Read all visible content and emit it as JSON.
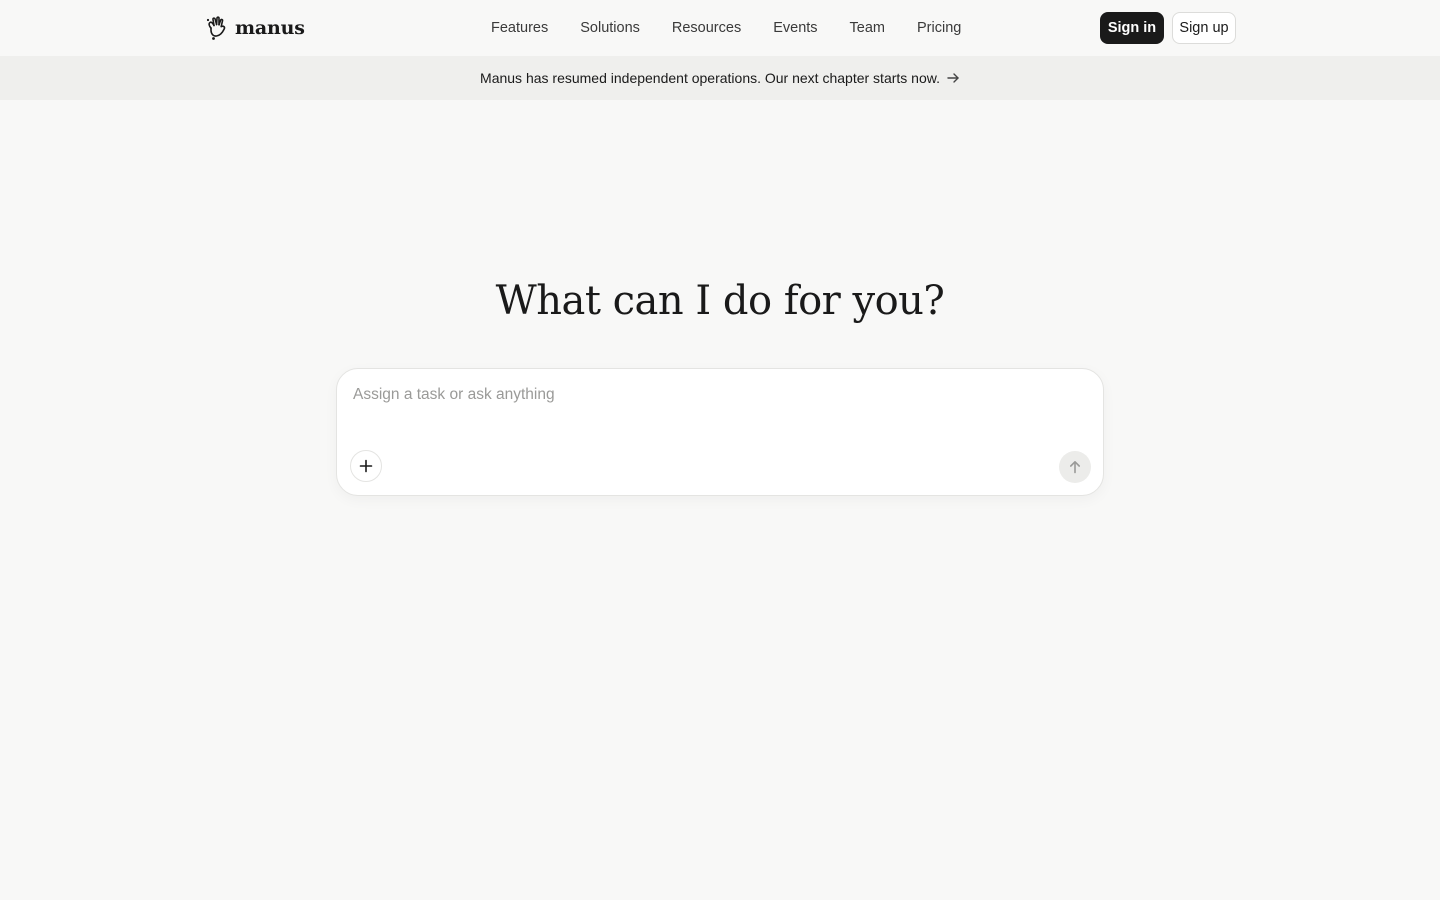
{
  "brand": {
    "name": "manus",
    "logo_icon": "manus-hand-logo"
  },
  "nav": {
    "items": [
      {
        "label": "Features"
      },
      {
        "label": "Solutions"
      },
      {
        "label": "Resources"
      },
      {
        "label": "Events"
      },
      {
        "label": "Team"
      },
      {
        "label": "Pricing"
      }
    ]
  },
  "auth": {
    "sign_in_label": "Sign in",
    "sign_up_label": "Sign up"
  },
  "banner": {
    "text": "Manus has resumed independent operations. Our next chapter starts now.",
    "icon": "arrow-right-icon"
  },
  "hero": {
    "title": "What can I do for you?"
  },
  "composer": {
    "value": "",
    "placeholder": "Assign a task or ask anything",
    "attach_icon": "plus-icon",
    "send_icon": "arrow-up-icon"
  },
  "colors": {
    "background": "#f8f8f7",
    "banner_background": "#efefed",
    "primary_button": "#1a1a1a",
    "text": "#1a1a1a",
    "placeholder": "#9a9a98",
    "send_button_disabled": "#ececea"
  }
}
